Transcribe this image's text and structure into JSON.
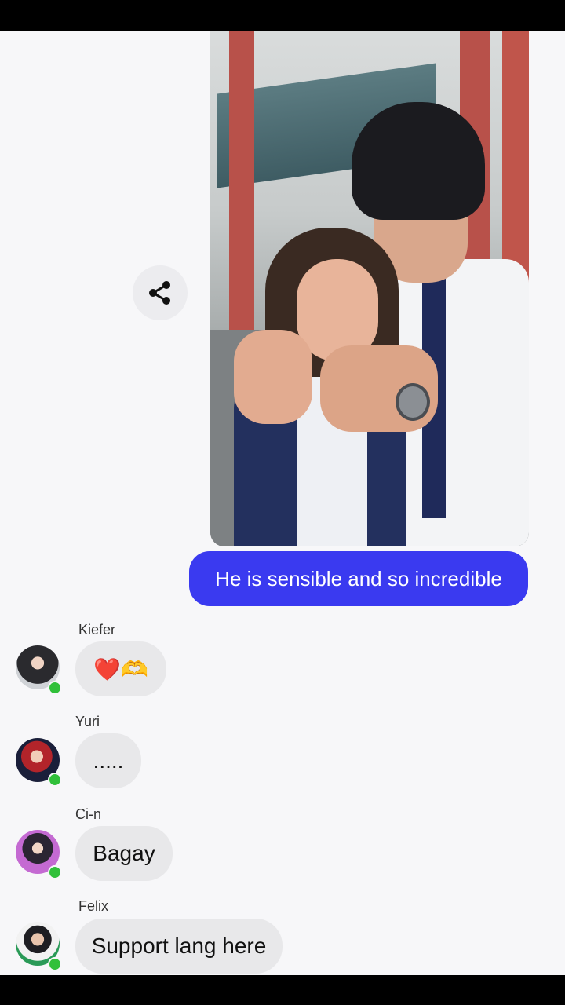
{
  "thread": {
    "shared_photo": {
      "description_icon": "photo-icon"
    },
    "share_button_icon": "share-icon",
    "my_message": "He is sensible and so incredible",
    "messages": [
      {
        "sender": "Kiefer",
        "text": "❤️🫶",
        "online": true
      },
      {
        "sender": "Yuri",
        "text": ".....",
        "online": true
      },
      {
        "sender": "Ci-n",
        "text": "Bagay",
        "online": true
      },
      {
        "sender": "Felix",
        "text": "Support lang here",
        "online": true
      }
    ]
  },
  "colors": {
    "my_bubble": "#3a3af0",
    "other_bubble": "#e8e8ea",
    "online_dot": "#31c03a",
    "background": "#f7f7f9"
  }
}
